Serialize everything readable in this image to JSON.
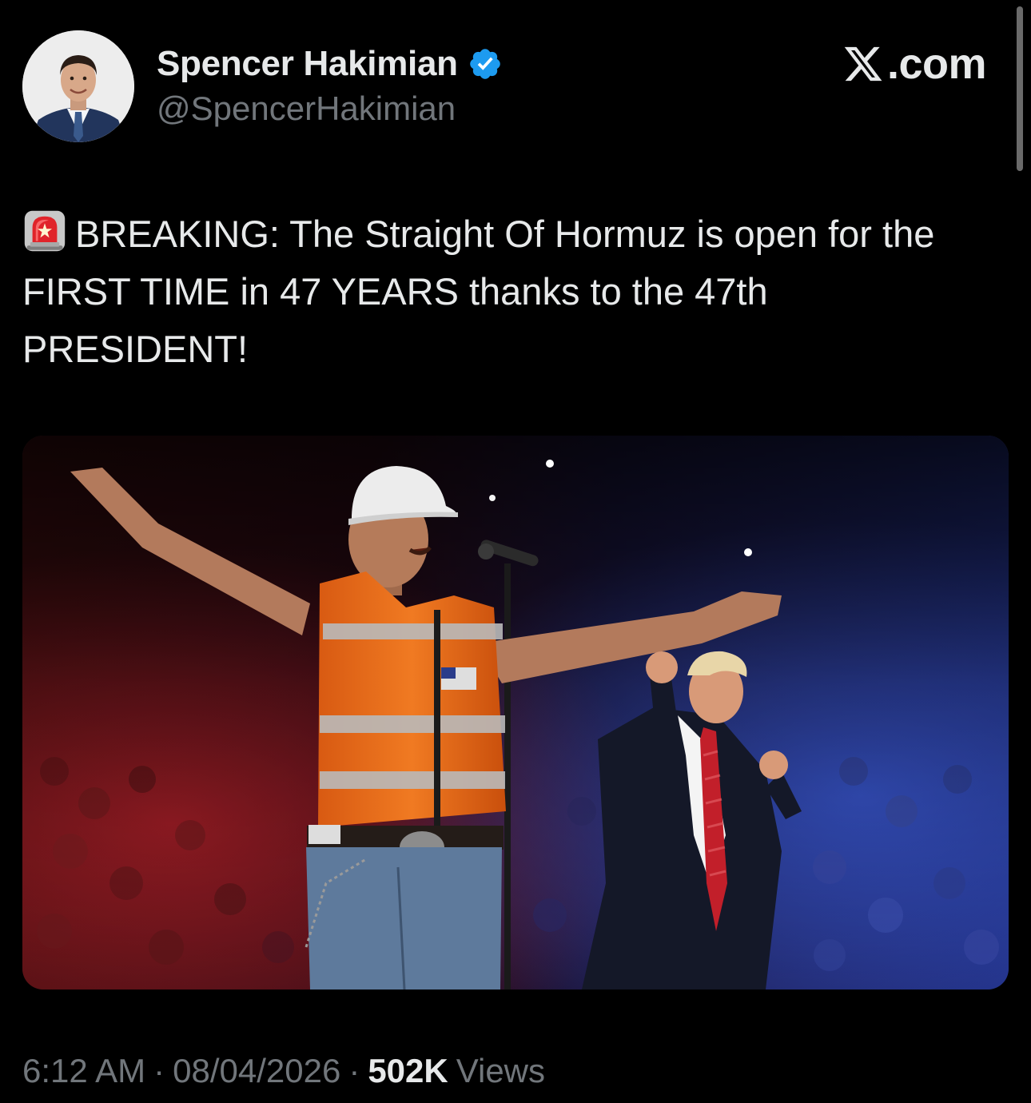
{
  "author": {
    "display_name": "Spencer Hakimian",
    "handle": "@SpencerHakimian",
    "verified": true,
    "verified_icon": "verified-badge-icon",
    "verified_color": "#1d9bf0"
  },
  "brand": {
    "logo_icon": "x-logo-icon",
    "text": ".com"
  },
  "tweet": {
    "emoji_icon": "police-siren-icon",
    "text": "BREAKING: The Straight Of Hormuz is open for the FIRST TIME in 47 YEARS thanks to the 47th PRESIDENT!"
  },
  "meta": {
    "time": "6:12 AM",
    "separator": "·",
    "date": "08/04/2026",
    "views_count": "502K",
    "views_label": "Views"
  },
  "colors": {
    "background": "#000000",
    "text_primary": "#e7e9ea",
    "text_secondary": "#71767b",
    "accent": "#1d9bf0"
  }
}
